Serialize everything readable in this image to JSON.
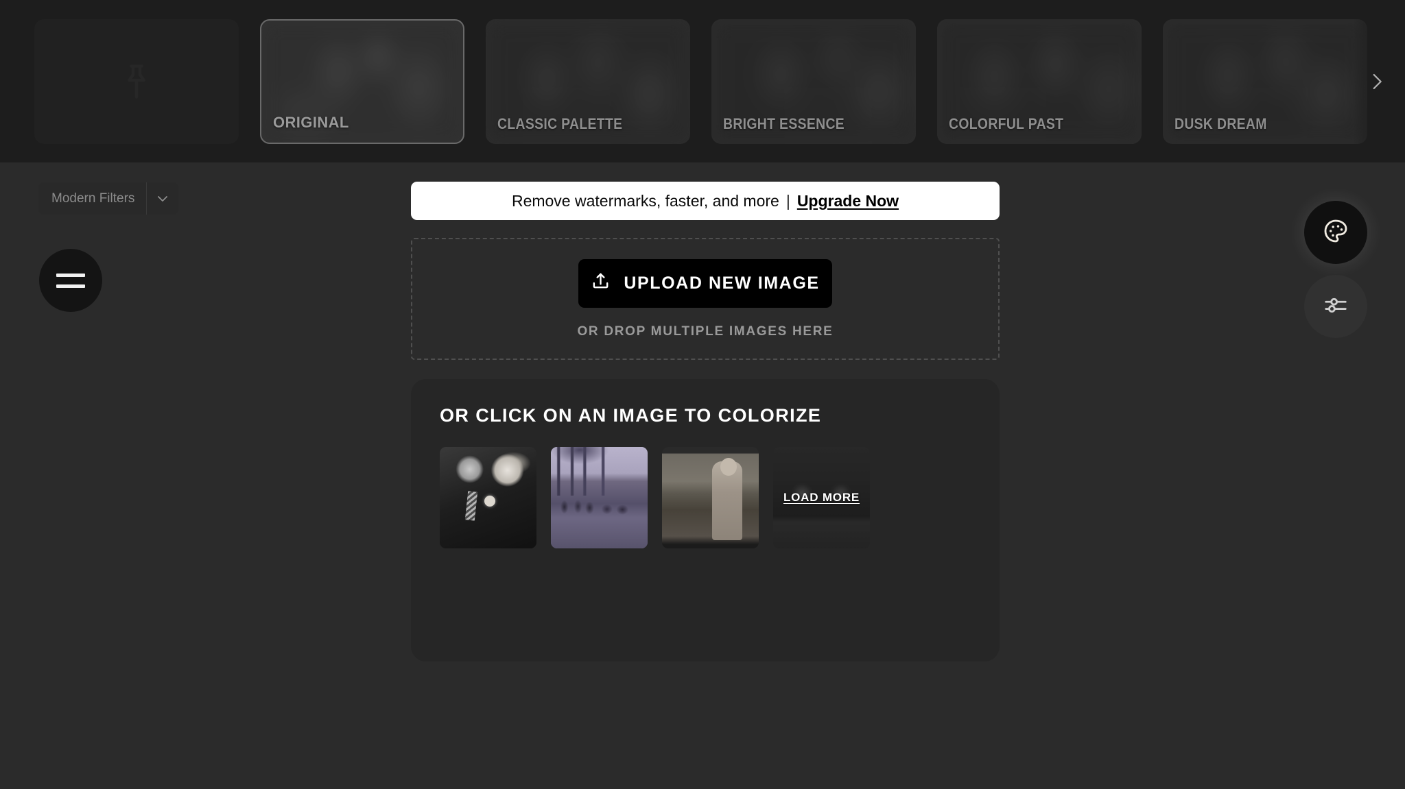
{
  "filter_strip": {
    "cards": [
      {
        "id": "pin-card",
        "label": "",
        "icon": "pin-icon",
        "selected": false,
        "is_pin": true
      },
      {
        "id": "original",
        "label": "ORIGINAL",
        "selected": true,
        "is_pin": false
      },
      {
        "id": "classic-palette",
        "label": "CLASSIC PALETTE",
        "selected": false,
        "is_pin": false
      },
      {
        "id": "bright-essence",
        "label": "BRIGHT ESSENCE",
        "selected": false,
        "is_pin": false
      },
      {
        "id": "colorful-past",
        "label": "COLORFUL PAST",
        "selected": false,
        "is_pin": false
      },
      {
        "id": "dusk-dream",
        "label": "DUSK DREAM",
        "selected": false,
        "is_pin": false
      }
    ],
    "next_icon": "chevron-right-icon"
  },
  "left_controls": {
    "filters_dropdown": {
      "label": "Modern Filters",
      "chevron_icon": "chevron-down-icon"
    },
    "menu_button": {
      "icon": "hamburger-menu-icon"
    }
  },
  "banner": {
    "text": "Remove watermarks, faster, and more",
    "separator": "|",
    "link_label": "Upgrade Now"
  },
  "upload": {
    "button_label": "UPLOAD NEW IMAGE",
    "button_icon": "upload-icon",
    "drop_hint": "OR DROP MULTIPLE IMAGES HERE"
  },
  "gallery": {
    "title": "OR CLICK ON AN IMAGE TO COLORIZE",
    "items": [
      {
        "name": "sample-couple-kissing",
        "art": "art-couple",
        "overlay": null
      },
      {
        "name": "sample-lakeside-group",
        "art": "art-lake",
        "overlay": null
      },
      {
        "name": "sample-porch-portrait",
        "art": "art-porch",
        "overlay": null
      },
      {
        "name": "load-more",
        "art": "art-kids",
        "overlay": "LOAD MORE"
      }
    ]
  },
  "right_tools": [
    {
      "name": "palette-tool",
      "icon": "palette-icon",
      "active": true
    },
    {
      "name": "adjustments-tool",
      "icon": "sliders-icon",
      "active": false
    }
  ],
  "colors": {
    "strip_bg": "#1d1d1d",
    "page_bg": "#2b2b2b",
    "panel_bg": "#262626",
    "banner_bg": "#ffffff",
    "upload_btn_bg": "#000000",
    "label_gray": "#8e8e8e"
  }
}
